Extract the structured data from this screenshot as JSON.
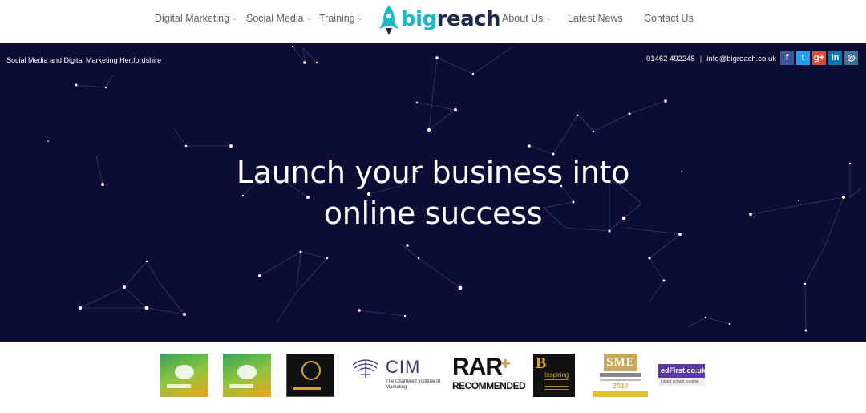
{
  "header": {
    "logo": {
      "part1": "big",
      "part2": "reach"
    },
    "nav": [
      {
        "label": "Digital Marketing",
        "has_dropdown": true
      },
      {
        "label": "Social Media",
        "has_dropdown": true
      },
      {
        "label": "Training",
        "has_dropdown": true
      },
      {
        "label": "About Us",
        "has_dropdown": true
      },
      {
        "label": "Latest News",
        "has_dropdown": false
      },
      {
        "label": "Contact Us",
        "has_dropdown": false
      }
    ]
  },
  "hero": {
    "tagline": "Social Media and Digital Marketing Hertfordshire",
    "phone": "01462 492245",
    "separator": "|",
    "email": "info@bigreach.co.uk",
    "headline_line1": "Launch your business into",
    "headline_line2": "online success",
    "background_color": "#0b0d35"
  },
  "social": [
    {
      "icon": "facebook-icon",
      "glyph": "f",
      "color": "#3b5998"
    },
    {
      "icon": "twitter-icon",
      "glyph": "t",
      "color": "#1da1f2"
    },
    {
      "icon": "google-plus-icon",
      "glyph": "g+",
      "color": "#dd4b39"
    },
    {
      "icon": "linkedin-icon",
      "glyph": "in",
      "color": "#0077b5"
    },
    {
      "icon": "instagram-icon",
      "glyph": "◎",
      "color": "#3f729b"
    }
  ],
  "awards": {
    "cim": {
      "abbr": "CIM",
      "sub": "The Chartered Institute of Marketing"
    },
    "rar": {
      "main": "RAR",
      "plus": "+",
      "sub": "RECOMMENDED"
    },
    "inspiring": {
      "letter": "B",
      "text": "Inspiring"
    },
    "sme": {
      "name": "SME",
      "year": "2017"
    },
    "edfirst": {
      "name": "edFirst.co.uk",
      "sub": "Listed school supplier"
    }
  }
}
